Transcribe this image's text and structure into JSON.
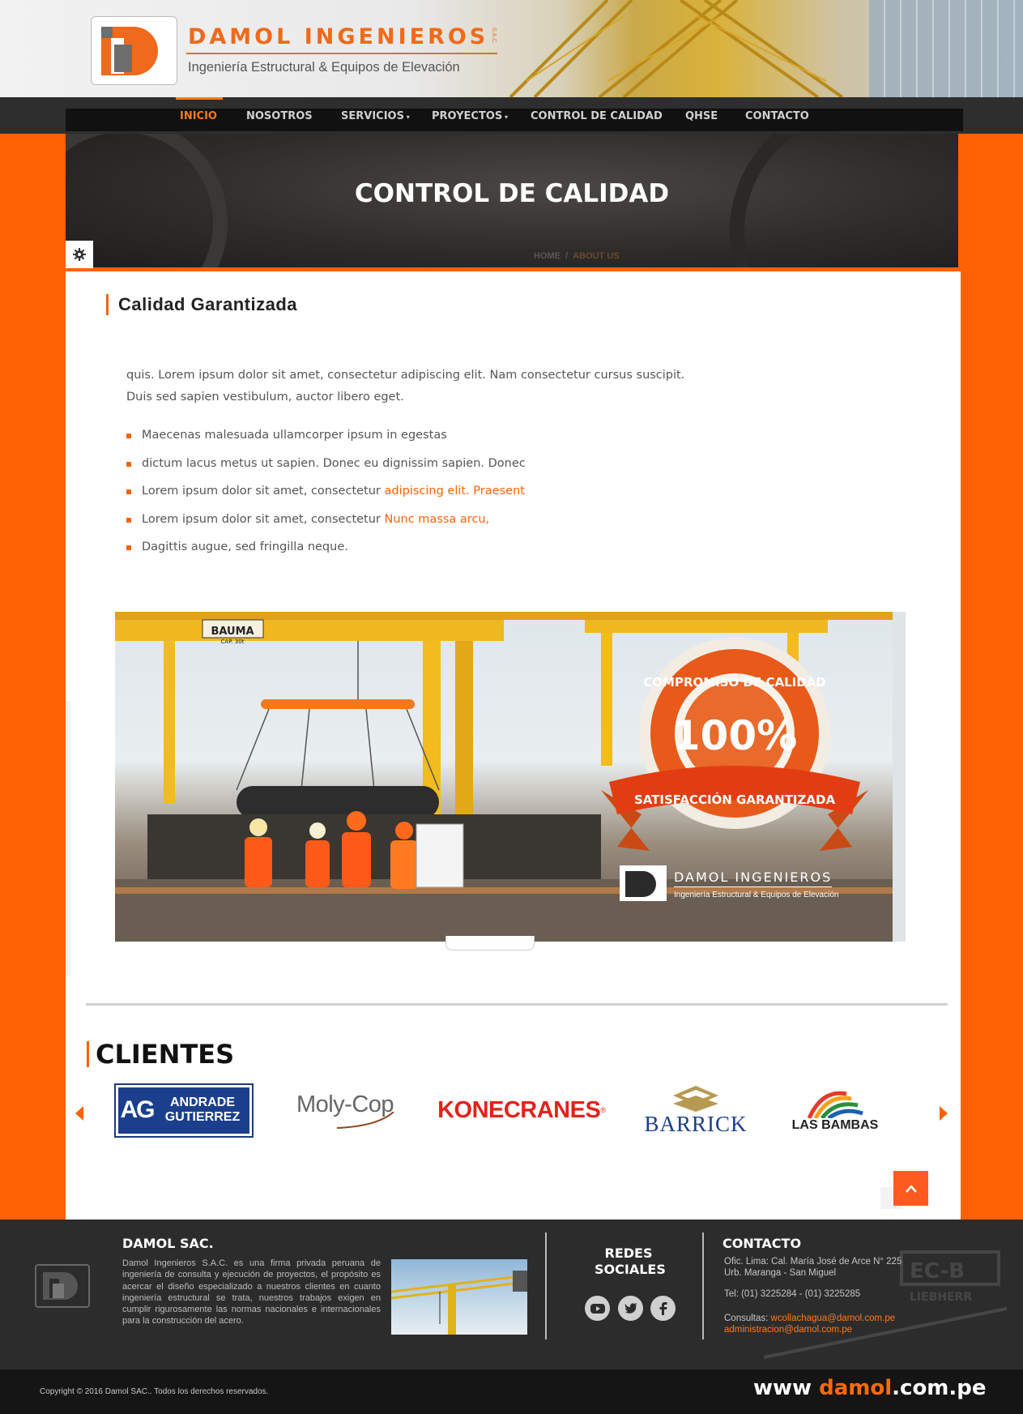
{
  "brand": {
    "name": "DAMOL INGENIEROS",
    "suffix": "S.A.C.",
    "tagline": "Ingeniería Estructural & Equipos de Elevación",
    "accent_color": "#ff6205"
  },
  "nav": {
    "items": [
      "INICIO",
      "NOSOTROS",
      "SERVICIOS",
      "PROYECTOS",
      "CONTROL DE CALIDAD",
      "QHSE",
      "CONTACTO"
    ],
    "active": "INICIO"
  },
  "hero": {
    "title": "CONTROL DE CALIDAD",
    "breadcrumb": [
      "HOME",
      "ABOUT US"
    ]
  },
  "content": {
    "section_title": "Calidad Garantizada",
    "paragraph": "quis. Lorem ipsum dolor sit amet, consectetur adipiscing elit. Nam consectetur cursus suscipit. Duis sed sapien vestibulum, auctor libero eget.",
    "bullets": [
      {
        "text": "Maecenas malesuada ullamcorper ipsum in egestas",
        "highlight": ""
      },
      {
        "text": "dictum lacus metus ut sapien. Donec eu dignissim sapien. Donec",
        "highlight": ""
      },
      {
        "text": "Lorem ipsum dolor sit amet, consectetur ",
        "highlight": "adipiscing elit. Praesent"
      },
      {
        "text": "Lorem ipsum dolor sit amet, consectetur ",
        "highlight": "Nunc massa arcu,"
      },
      {
        "text": "Dagittis augue, sed fringilla neque.",
        "highlight": ""
      }
    ]
  },
  "banner": {
    "sign_text": "BAUMA",
    "sign_sub": "CAP. 30t",
    "badge_top": "COMPROMISO DE CALIDAD",
    "badge_value": "100%",
    "badge_ribbon": "SATISFACCIÓN GARANTIZADA",
    "logo_name": "DAMOL INGENIEROS",
    "logo_tagline": "Ingeniería Estructural & Equipos de Elevación"
  },
  "clients": {
    "title": "CLIENTES",
    "logos": [
      {
        "mark": "AG",
        "line1": "ANDRADE",
        "line2": "GUTIERREZ"
      },
      {
        "name": "Moly-Cop"
      },
      {
        "name": "KONECRANES",
        "mark": "®"
      },
      {
        "name": "BARRICK"
      },
      {
        "name": "LAS BAMBAS"
      }
    ]
  },
  "footer": {
    "company_title": "DAMOL SAC.",
    "description": "Damol Ingenieros S.A.C. es una firma privada peruana de ingeniería de consulta y ejecución de proyectos, el propósito es acercar el diseño especializado a nuestros clientes en cuanto ingeniería estructural se trata, nuestros trabajos exigen en cumplir rigurosamente las normas nacionales e internacionales para la construcción del acero.",
    "social_title_1": "REDES",
    "social_title_2": "SOCIALES",
    "social_icons": [
      "youtube-icon",
      "twitter-icon",
      "facebook-icon"
    ],
    "contact_title": "CONTACTO",
    "address_1": "Ofic. Lima: Cal. María José de Arce N° 225",
    "address_2": "Urb. Maranga - San Miguel",
    "phone": "Tel: (01) 3225284 - (01) 3225285",
    "consultas_label": "Consultas: ",
    "email_1": "wcollachagua@damol.com.pe",
    "email_2": "administracion@damol.com.pe",
    "ghost_text": "EC-B",
    "ghost_brand": "LIEBHERR",
    "copyright": "Copyright © 2016 Damol SAC.. Todos los derechos reservados.",
    "www_prefix": "www ",
    "www_brand": "damol",
    "www_suffix": ".com.pe"
  }
}
